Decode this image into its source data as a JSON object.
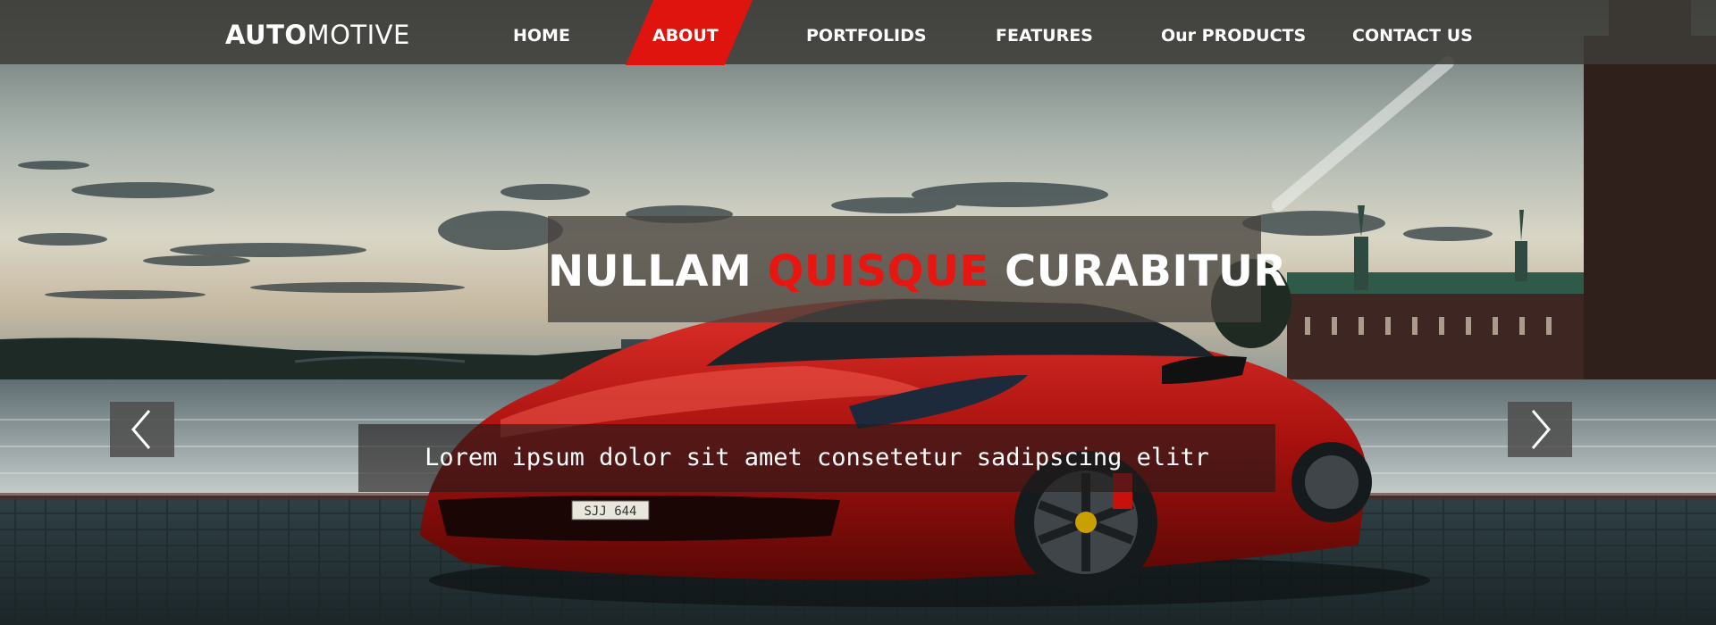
{
  "brand": {
    "bold": "AUTO",
    "light": "MOTIVE"
  },
  "nav": {
    "items": [
      {
        "label": "HOME"
      },
      {
        "label": "ABOUT",
        "active": true
      },
      {
        "label": "PORTFOLIDS"
      },
      {
        "label": "FEATURES"
      },
      {
        "label": "Our PRODUCTS"
      },
      {
        "label": "CONTACT US"
      }
    ]
  },
  "hero": {
    "headline_part1": "NULLAM ",
    "headline_accent": "QUISQUE",
    "headline_part2": " CURABITUR",
    "subtitle": "Lorem ipsum dolor sit amet consetetur sadipscing elitr",
    "plate": "SJJ 644"
  },
  "carousel": {
    "prev_icon": "chevron-left-icon",
    "next_icon": "chevron-right-icon"
  },
  "colors": {
    "accent": "#e0140f",
    "nav_bg": "#3e3c38",
    "text": "#ffffff"
  }
}
